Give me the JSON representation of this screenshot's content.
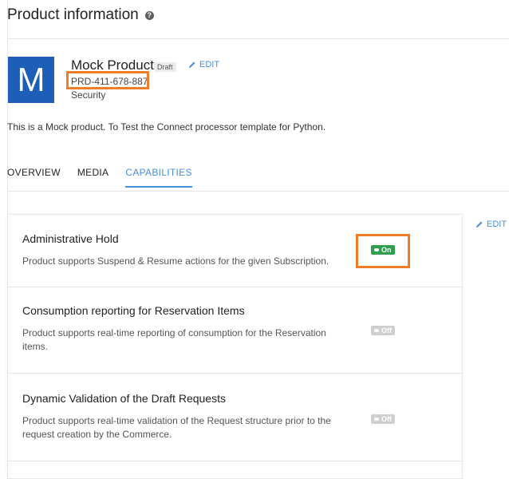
{
  "page": {
    "title": "Product information",
    "help_icon": "help-circle-icon"
  },
  "product": {
    "avatar_letter": "M",
    "name": "Mock Product",
    "status_badge": "Draft",
    "edit_label": "EDIT",
    "id": "PRD-411-678-887",
    "category": "Security",
    "description": "This is a Mock product. To Test the Connect processor template for Python."
  },
  "tabs": [
    {
      "label": "OVERVIEW",
      "active": false
    },
    {
      "label": "MEDIA",
      "active": false
    },
    {
      "label": "CAPABILITIES",
      "active": true
    }
  ],
  "capabilities": {
    "edit_label": "EDIT",
    "items": [
      {
        "title": "Administrative Hold",
        "description": "Product supports Suspend & Resume actions for the given Subscription.",
        "state": "On"
      },
      {
        "title": "Consumption reporting for Reservation Items",
        "description": "Product supports real-time reporting of consumption for the Reservation items.",
        "state": "Off"
      },
      {
        "title": "Dynamic Validation of the Draft Requests",
        "description": "Product supports real-time validation of the Request structure prior to the request creation by the Commerce.",
        "state": "Off"
      }
    ]
  },
  "colors": {
    "accent": "#4a8ed6",
    "on": "#2e9e4f",
    "off": "#cfcfcf",
    "highlight": "#ef7d2a",
    "avatar": "#1d5fb8"
  }
}
